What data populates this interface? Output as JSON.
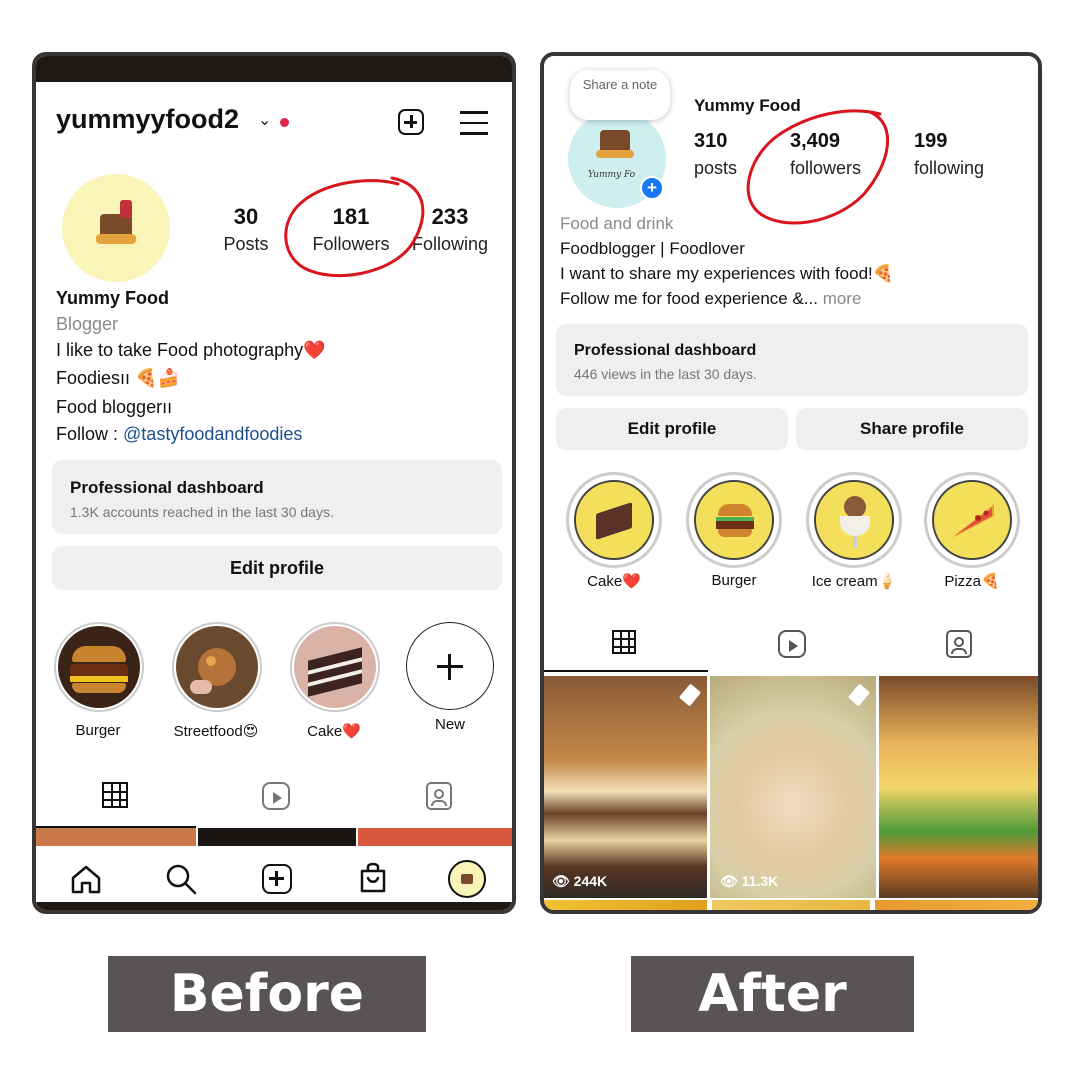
{
  "before": {
    "username": "yummyyfood2",
    "stats": [
      {
        "value": "30",
        "label": "Posts"
      },
      {
        "value": "181",
        "label": "Followers"
      },
      {
        "value": "233",
        "label": "Following"
      }
    ],
    "name": "Yummy Food",
    "category": "Blogger",
    "bio": [
      "I like to take Food photography❤️",
      "Foodiesıı 🍕🍰",
      "Food bloggerıı"
    ],
    "follow_prefix": "Follow : ",
    "follow_handle": "@tastyfoodandfoodies",
    "dashboard": {
      "title": "Professional dashboard",
      "subtitle": "1.3K accounts reached in the last 30 days."
    },
    "edit_profile": "Edit profile",
    "highlights": [
      "Burger",
      "Streetfood😍",
      "Cake❤️",
      "New"
    ],
    "label": "Before"
  },
  "after": {
    "note_bubble": "Share a note",
    "avatar_text": "Yummy Fo",
    "name": "Yummy Food",
    "stats": [
      {
        "value": "310",
        "label": "posts"
      },
      {
        "value": "3,409",
        "label": "followers"
      },
      {
        "value": "199",
        "label": "following"
      }
    ],
    "category": "Food and drink",
    "bio": [
      "Foodblogger | Foodlover",
      "I want to share my experiences with food!🍕"
    ],
    "bio_last": "Follow me for food experience &...",
    "more": " more",
    "dashboard": {
      "title": "Professional dashboard",
      "subtitle": "446 views in the last 30 days."
    },
    "edit_profile": "Edit profile",
    "share_profile": "Share profile",
    "highlights": [
      "Cake❤️",
      "Burger",
      "Ice cream🍦",
      "Pizza🍕"
    ],
    "posts": [
      {
        "views": "244K"
      },
      {
        "views": "11.3K"
      },
      {
        "views": ""
      }
    ],
    "label": "After"
  },
  "colors": {
    "annotation": "#d9141c",
    "label_bg": "#595353",
    "link": "#1d4f91",
    "highlight_yellow": "#f4df5a"
  }
}
